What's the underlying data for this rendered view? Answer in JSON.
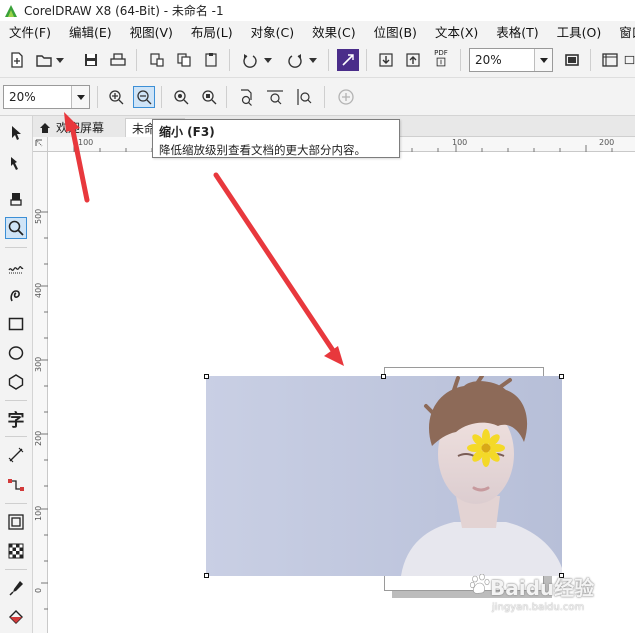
{
  "window": {
    "title": "CorelDRAW X8 (64-Bit) - 未命名 -1"
  },
  "menu": [
    {
      "label": "文件(F)"
    },
    {
      "label": "编辑(E)"
    },
    {
      "label": "视图(V)"
    },
    {
      "label": "布局(L)"
    },
    {
      "label": "对象(C)"
    },
    {
      "label": "效果(C)"
    },
    {
      "label": "位图(B)"
    },
    {
      "label": "文本(X)"
    },
    {
      "label": "表格(T)"
    },
    {
      "label": "工具(O)"
    },
    {
      "label": "窗口"
    }
  ],
  "toolbar1": {
    "zoom_value": "20%",
    "pdf_label": "PDF"
  },
  "toolbar2": {
    "zoom_value": "20%"
  },
  "tabs": {
    "welcome": "欢迎屏幕",
    "untitled": "未命"
  },
  "tooltip": {
    "title": "缩小 (F3)",
    "description": "降低缩放级别查看文档的更大部分内容。"
  },
  "ruler": {
    "h_labels": [
      "100",
      "100",
      "200"
    ],
    "v_labels": [
      "500",
      "400",
      "300",
      "200",
      "100",
      "0"
    ]
  },
  "watermark": {
    "text": "Baidu经验",
    "url": "jingyan.baidu.com"
  },
  "colors": {
    "accent": "#3c8fd6",
    "annotation_arrow": "#e8383d"
  }
}
